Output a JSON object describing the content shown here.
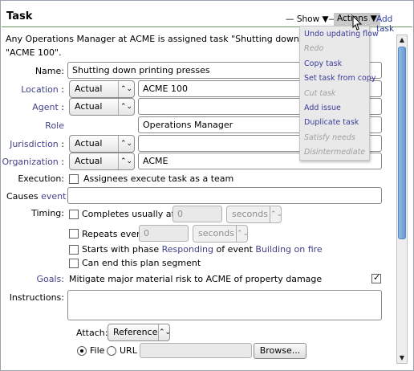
{
  "header": {
    "title": "Task",
    "show_label": "— Show ▼—",
    "actions_label": "Actions",
    "add_task_label": "Add task"
  },
  "summary": {
    "line1": "Any Operations Manager at ACME is assigned task \"Shutting down printing p",
    "line2": "\"ACME 100\"."
  },
  "form": {
    "name_label": "Name:",
    "name_value": "Shutting down printing presses",
    "location_label": "Location",
    "location_mode": "Actual",
    "location_value": "ACME 100",
    "agent_label": "Agent",
    "agent_mode": "Actual",
    "agent_value": "",
    "role_label": "Role",
    "role_value": "Operations Manager",
    "jurisdiction_label": "Jurisdiction",
    "jurisdiction_mode": "Actual",
    "jurisdiction_value": "",
    "organization_label": "Organization",
    "organization_mode": "Actual",
    "organization_value": "ACME",
    "colon": ":",
    "execution_label": "Execution:",
    "execution_option": "Assignees execute task as a team",
    "causes_label": "Causes",
    "causes_link": "event",
    "causes_value": "",
    "timing_label": "Timing:",
    "completes_label": "Completes usually after",
    "completes_value": "0",
    "completes_unit": "seconds",
    "repeats_label": "Repeats every",
    "repeats_value": "0",
    "repeats_unit": "seconds",
    "phase_prefix": "Starts with phase",
    "phase_link": "Responding",
    "phase_mid": "of event",
    "phase_event_link": "Building on fire",
    "can_end_label": "Can end this plan segment",
    "goals_label": "Goals:",
    "goals_text": "Mitigate major material risk to ACME of property damage",
    "instructions_label": "Instructions:",
    "instructions_value": "",
    "attach_label": "Attach:",
    "attach_type": "Reference",
    "file_label": "File",
    "url_label": "URL",
    "browse_label": "Browse..."
  },
  "actions_menu": {
    "items": [
      {
        "label": "Undo updating flow",
        "enabled": true
      },
      {
        "label": "Redo",
        "enabled": false
      },
      {
        "label": "Copy task",
        "enabled": true
      },
      {
        "label": "Set task from copy",
        "enabled": true
      },
      {
        "label": "Cut task",
        "enabled": false
      },
      {
        "label": "Add issue",
        "enabled": true
      },
      {
        "label": "Duplicate task",
        "enabled": true
      },
      {
        "label": "Satisfy needs",
        "enabled": false
      },
      {
        "label": "Disintermediate",
        "enabled": false
      }
    ]
  },
  "colors": {
    "link": "#42428a",
    "header_rule": "#6a9a58",
    "scroll_thumb": "#7aaade"
  }
}
